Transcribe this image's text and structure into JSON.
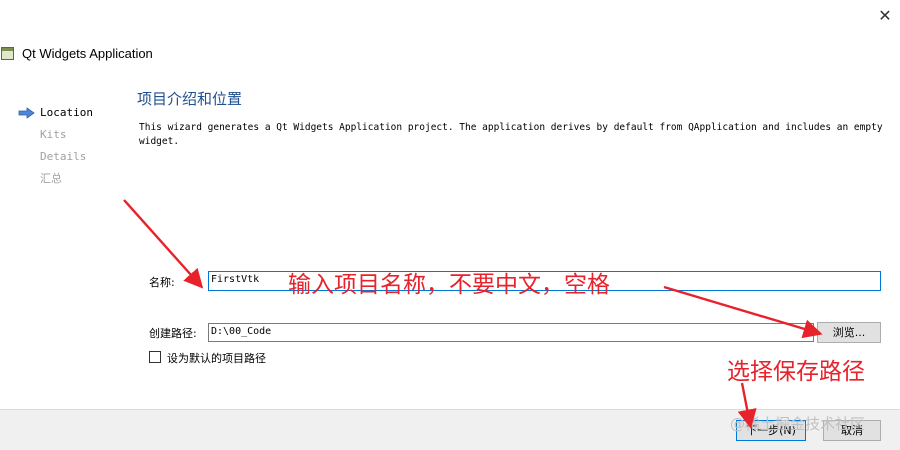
{
  "window": {
    "title": "Qt Widgets Application",
    "close_glyph": "✕"
  },
  "steps": [
    {
      "label": "Location",
      "active": true
    },
    {
      "label": "Kits",
      "active": false
    },
    {
      "label": "Details",
      "active": false
    },
    {
      "label": "汇总",
      "active": false
    }
  ],
  "page": {
    "title": "项目介绍和位置",
    "description": "This wizard generates a Qt Widgets Application project. The application derives by default from QApplication and includes an empty widget."
  },
  "form": {
    "name_label": "名称:",
    "name_value": "FirstVtk",
    "path_label": "创建路径:",
    "path_value": "D:\\00_Code",
    "browse_label": "浏览...",
    "default_path_label": "设为默认的项目路径",
    "default_path_checked": false
  },
  "footer": {
    "next_label": "下一步(N)",
    "cancel_label": "取消"
  },
  "annotations": {
    "name_hint": "输入项目名称，不要中文，空格",
    "path_hint": "选择保存路径",
    "color": "#e8222b"
  },
  "watermark": "@稀土掘金技术社区"
}
